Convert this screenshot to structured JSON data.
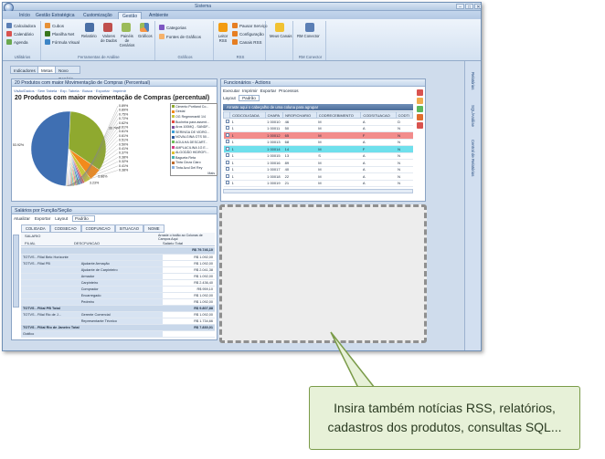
{
  "window": {
    "title": "Sistema"
  },
  "ribbon_tabs": [
    "Início",
    "Gestão Estratégica",
    "Customização",
    "Gestão",
    "Ambiente"
  ],
  "ribbon": {
    "utilitarios": {
      "items": [
        "Calculadora",
        "Calendário",
        "Agenda"
      ],
      "label": "Utilitários"
    },
    "analise": {
      "items": [
        "Cubos",
        "Planilha Net",
        "Fórmula Visual"
      ],
      "big": [
        "Relatório",
        "Valores de Dados",
        "Painéis de Cenários",
        "Gráficos"
      ],
      "label": "Ferramentas de Análise"
    },
    "graficos": {
      "items": [
        "Categorias",
        "Fontes de Gráficos"
      ],
      "label": "Gráficos"
    },
    "rss": {
      "big": [
        "Leitor RSS"
      ],
      "items": [
        "Pausar Serviço",
        "Configuração",
        "Canais RSS"
      ],
      "label": "RSS"
    },
    "canais": {
      "big": [
        "Meus Canais"
      ],
      "label": ""
    },
    "conector": {
      "big": [
        "RM Conector"
      ],
      "label": "RM Conector"
    }
  },
  "doc_tabs": [
    "Indicadores",
    "Metas",
    "Novo Cenário..."
  ],
  "chart_panel": {
    "header": "20 Produtos com maior Movimentação de Compras (Percentual)",
    "links": "Visão/Dados · Sem Tabela · Exp. Tabela · Busca · Exportar · Imprimir",
    "title": "20 Produtos com maior movimentação de Compras (percentual)",
    "more": "Mais",
    "legend": [
      "Cimento Portland Co...",
      "Gestal",
      "OG Regenerantil 1/4",
      "Bucheira para assent...",
      "Aros 100MQ - SANDF...",
      "SERINGA DE VIDRO...",
      "NOVALGINA GTS 50...",
      "AGULHA DESCART...",
      "AMPLACILINA 1G E...",
      "ALGODÃO HIDROFI...",
      "Bagueta Reta",
      "Tinta Cinza Claro",
      "Tinta Azul Del Rey"
    ]
  },
  "chart_data": {
    "type": "pie",
    "title": "20 Produtos com maior movimentação de Compras (percentual)",
    "labels": [
      "53.92%",
      "0.89%",
      "0.89%",
      "0.75%",
      "0.72%",
      "0.62%",
      "0.61%",
      "0.61%",
      "0.61%",
      "0.51%",
      "0.50%",
      "0.41%",
      "0.37%",
      "0.38%",
      "0.32%",
      "0.41%",
      "0.38%",
      "5.86%",
      "3.23%",
      "36.74%"
    ],
    "slices": [
      {
        "value": 36.74,
        "color": "#8fa92f",
        "label": "36.74%"
      },
      {
        "value": 5.86,
        "color": "#f28a1c",
        "label": "5.86%"
      },
      {
        "value": 3.23,
        "color": "#c8c53a",
        "label": "3.23%"
      },
      {
        "value": 0.89,
        "color": "#e44b41",
        "label": "0.89%"
      },
      {
        "value": 0.89,
        "color": "#7b4f9d",
        "label": "0.89%"
      },
      {
        "value": 0.75,
        "color": "#3c9fd8",
        "label": "0.75%"
      },
      {
        "value": 0.72,
        "color": "#2b5aa0",
        "label": "0.72%"
      },
      {
        "value": 0.62,
        "color": "#6dbf59",
        "label": "0.62%"
      },
      {
        "value": 0.61,
        "color": "#d43c87",
        "label": "0.61%"
      },
      {
        "value": 0.61,
        "color": "#e0c12f",
        "label": "0.61%"
      },
      {
        "value": 0.61,
        "color": "#46b3b3",
        "label": "0.61%"
      },
      {
        "value": 0.51,
        "color": "#bf6c2c",
        "label": "0.51%"
      },
      {
        "value": 0.5,
        "color": "#9a9a9a",
        "label": "0.50%"
      },
      {
        "value": 0.41,
        "color": "#86b0e2",
        "label": "0.41%"
      },
      {
        "value": 0.37,
        "color": "#f2a7c8",
        "label": "0.37%"
      },
      {
        "value": 0.38,
        "color": "#c9e2a6",
        "label": "0.38%"
      },
      {
        "value": 0.32,
        "color": "#5f3f8f",
        "label": "0.32%"
      },
      {
        "value": 0.41,
        "color": "#e6d590",
        "label": "0.41%"
      },
      {
        "value": 0.38,
        "color": "#6a8fc2",
        "label": "0.38%"
      },
      {
        "value": 53.92,
        "color": "#3f6fb2",
        "label": "53.92%"
      }
    ]
  },
  "func_panel": {
    "header": "Funcionários - Actions",
    "toolbar": [
      "Executar",
      "Imprimir",
      "Exportar",
      "Processos"
    ],
    "layout": "Layout",
    "padrao": "Padrão",
    "group_hint": "Arraste aqui o cabeçalho de uma coluna para agrupar",
    "columns": [
      "",
      "CODCOLIGADA",
      "CHAPA",
      "NROFICHARIO",
      "CODRECEBIMENTO",
      "CODSITUACAO",
      "CODTI"
    ],
    "rows": [
      [
        "1",
        "1 00010",
        "46",
        "M",
        "A",
        "D"
      ],
      [
        "1",
        "1 00011",
        "50",
        "M",
        "A",
        "N"
      ],
      [
        "1",
        "1 00012",
        "65",
        "M",
        "F",
        "N"
      ],
      [
        "1",
        "1 00013",
        "68",
        "M",
        "A",
        "N"
      ],
      [
        "1",
        "1 00014",
        "14",
        "M",
        "F",
        "N"
      ],
      [
        "1",
        "1 00015",
        "13",
        "S",
        "A",
        "N"
      ],
      [
        "1",
        "1 00016",
        "89",
        "M",
        "A",
        "N"
      ],
      [
        "1",
        "1 00017",
        "40",
        "M",
        "A",
        "N"
      ],
      [
        "1",
        "1 00018",
        "22",
        "M",
        "A",
        "N"
      ],
      [
        "1",
        "1 00019",
        "21",
        "M",
        "A",
        "N"
      ]
    ]
  },
  "sal_panel": {
    "header": "Salários por Função/Seção",
    "toolbar": [
      "Atualizar",
      "Exportar",
      "Layout",
      "Padrão"
    ],
    "tabs": [
      "COLIGADA",
      "CODSECAO",
      "CODFUNCAO",
      "SITUACAO",
      "NOME"
    ],
    "salario": "SALARIO",
    "hint": "Arraste o botão ao Colunas de Campos Aqui",
    "col_filial": "FILIAL",
    "col_func": "DESCFUNCAO",
    "col_total": "Salário Total",
    "rows": [
      [
        "",
        "",
        "R$ 79.746,10"
      ],
      [
        "TOTVS - Filial Belo Horizonte",
        "",
        "R$ 1.092,00"
      ],
      [
        "TOTVS - Filial PB",
        "Ajudante Armação",
        "R$ 1.092,00"
      ],
      [
        "",
        "Ajudante de Carpinteiro",
        "R$ 2.041,38"
      ],
      [
        "",
        "Armador",
        "R$ 1.092,00"
      ],
      [
        "",
        "Carpinteiro",
        "R$ 2.436,40"
      ],
      [
        "",
        "Comprador",
        "R$ 959,10"
      ],
      [
        "",
        "Encarregado",
        "R$ 1.092,00"
      ],
      [
        "",
        "Pedreiro",
        "R$ 1.092,00"
      ],
      [
        "TOTVS - Filial PB Total",
        "",
        "R$ 9.807,88"
      ],
      [
        "TOTVS - Filial Rio de J...",
        "Gerente Comercial",
        "R$ 1.092,00"
      ],
      [
        "",
        "Representante Técnico",
        "R$ 1.734,66"
      ],
      [
        "TOTVS - Filial Rio de Janeiro Total",
        "",
        "R$ 7.830,01"
      ],
      [
        "Gráfico",
        "",
        ""
      ]
    ]
  },
  "sidebar": [
    "Relatórios",
    "SQL/Análise",
    "Central de Relatórios"
  ],
  "callout": {
    "line1": "Insira também notícias RSS, relatórios,",
    "line2": "cadastros dos produtos, consultas SQL..."
  }
}
